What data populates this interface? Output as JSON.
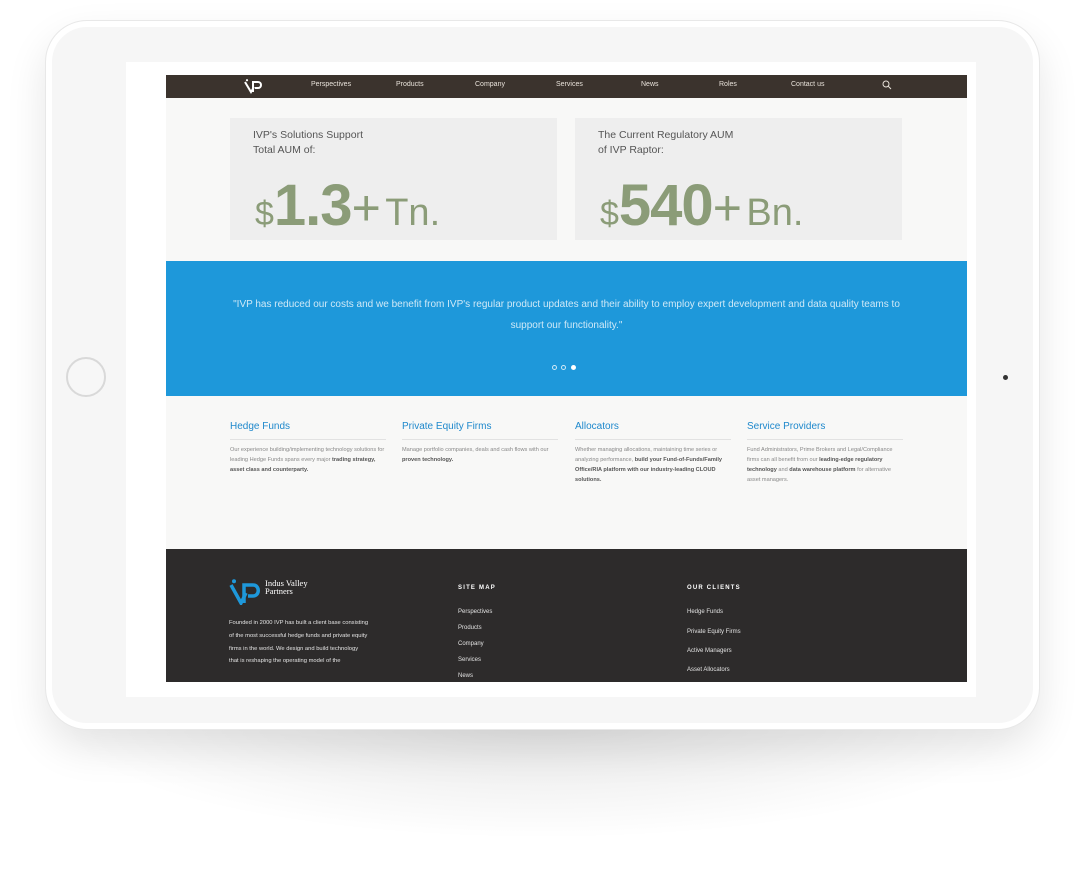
{
  "nav": {
    "items": [
      "Perspectives",
      "Products",
      "Company",
      "Services",
      "News",
      "Roles",
      "Contact us"
    ]
  },
  "stats": [
    {
      "label_line1": "IVP's Solutions Support",
      "label_line2": "Total AUM of:",
      "currency": "$",
      "number": "1.3",
      "plus": "+",
      "unit": "Tn."
    },
    {
      "label_line1": "The Current Regulatory AUM",
      "label_line2": "of IVP Raptor:",
      "currency": "$",
      "number": "540",
      "plus": "+",
      "unit": "Bn."
    }
  ],
  "testimonial": {
    "quote": "\"IVP has reduced our costs and we benefit from IVP's regular product updates and their ability to employ expert development and data quality teams to support our functionality.\"",
    "active_slide": 3,
    "slide_count": 3
  },
  "features": [
    {
      "title": "Hedge Funds",
      "desc_parts": [
        "Our experience building/implementing technology solutions for leading Hedge Funds spans every major ",
        "trading strategy, asset class and counterparty."
      ]
    },
    {
      "title": "Private Equity Firms",
      "desc_parts": [
        "Manage portfolio companies, deals and cash flows with our ",
        "proven technology."
      ]
    },
    {
      "title": "Allocators",
      "desc_parts": [
        "Whether managing allocations, maintaining time series or analyzing performance, ",
        "build your Fund-of-Funds/Family Office/RIA platform with our industry-leading CLOUD solutions."
      ]
    },
    {
      "title": "Service Providers",
      "desc_parts": [
        "Fund Administrators, Prime Brokers and Legal/Compliance firms can all benefit from our ",
        "leading-edge regulatory technology",
        " and ",
        "data warehouse platform",
        " for alternative asset managers."
      ]
    }
  ],
  "footer": {
    "logo_line1": "Indus Valley",
    "logo_line2": "Partners",
    "about": "Founded in 2000 IVP has built a client base consisting of the most successful hedge funds and private equity firms in the world. We design and build technology that is reshaping the operating model of the",
    "sitemap_heading": "SITE MAP",
    "sitemap_links": [
      "Perspectives",
      "Products",
      "Company",
      "Services",
      "News"
    ],
    "clients_heading": "OUR CLIENTS",
    "clients_links": [
      "Hedge Funds",
      "Private Equity Firms",
      "Active Managers",
      "Asset Allocators"
    ]
  },
  "colors": {
    "nav_bg": "#3b332d",
    "accent_blue": "#1e98da",
    "stat_green": "#8b9c78",
    "footer_bg": "#2d2b2b"
  },
  "icons": [
    "ivp-logo-icon",
    "search-icon"
  ]
}
